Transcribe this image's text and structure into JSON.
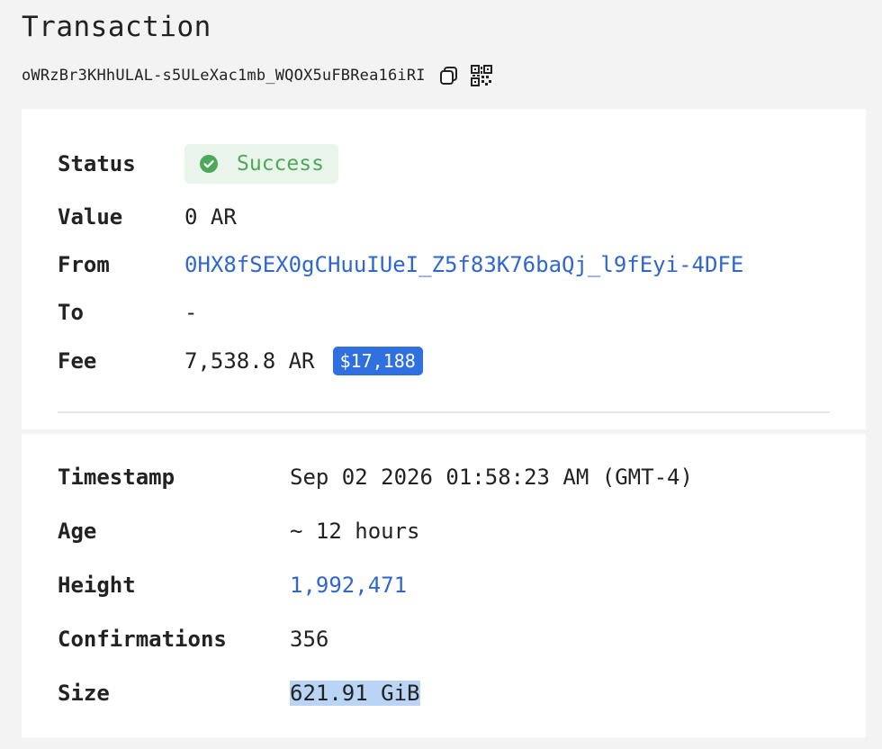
{
  "header": {
    "title": "Transaction",
    "tx_id": "oWRzBr3KHhULAL-s5ULeXac1mb_WQOX5uFBRea16iRI",
    "copy_icon": "copy-icon",
    "qr_icon": "qr-code-icon"
  },
  "summary": {
    "status": {
      "label": "Status",
      "value": "Success",
      "icon": "check-circle-icon",
      "color": "#4ea85a"
    },
    "value": {
      "label": "Value",
      "value": "0 AR"
    },
    "from": {
      "label": "From",
      "value": "0HX8fSEX0gCHuuIUeI_Z5f83K76baQj_l9fEyi-4DFE"
    },
    "to": {
      "label": "To",
      "value": "-"
    },
    "fee": {
      "label": "Fee",
      "value": "7,538.8 AR",
      "usd": "$17,188"
    }
  },
  "details": {
    "timestamp": {
      "label": "Timestamp",
      "value": "Sep 02 2026 01:58:23 AM (GMT-4)"
    },
    "age": {
      "label": "Age",
      "value": "~ 12 hours"
    },
    "height": {
      "label": "Height",
      "value": "1,992,471"
    },
    "confirmations": {
      "label": "Confirmations",
      "value": "356"
    },
    "size": {
      "label": "Size",
      "value": "621.91 GiB"
    }
  },
  "colors": {
    "link": "#2f66d0",
    "usd_badge": "#2f6fe0",
    "success_bg": "#e9f4ea",
    "selection": "#b9d4f5"
  }
}
